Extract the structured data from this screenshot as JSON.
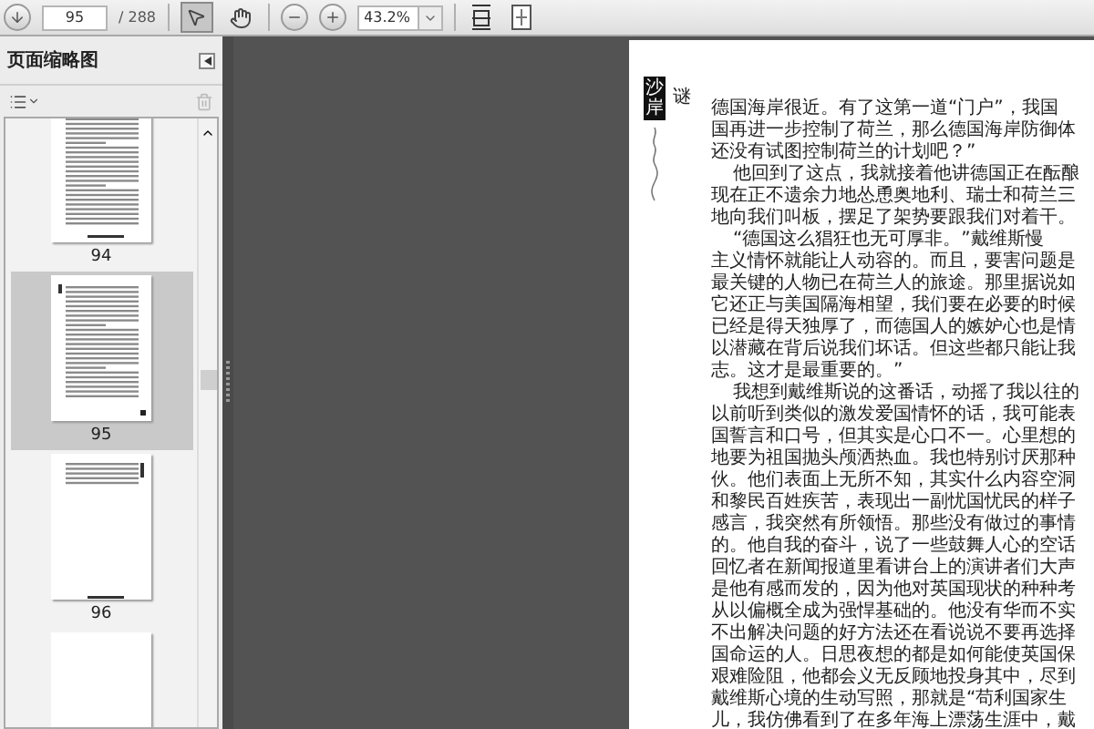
{
  "toolbar": {
    "page_input": "95",
    "page_total": "/ 288",
    "zoom_value": "43.2%",
    "tools": [
      {
        "kind": "select",
        "selected": true
      },
      {
        "kind": "hand",
        "selected": false
      }
    ]
  },
  "sidebar": {
    "title": "页面缩略图",
    "thumbnails": [
      {
        "kind": "text",
        "label": "94",
        "selected": false
      },
      {
        "kind": "chapter",
        "label": "95",
        "selected": true
      },
      {
        "kind": "short",
        "label": "96",
        "selected": false
      },
      {
        "kind": "blank",
        "selected": false
      }
    ]
  },
  "document": {
    "chapter_tag": "沙岸",
    "chapter_mark": "谜",
    "lines": [
      {
        "text": "德国海岸很近。有了这第一道“门户”，我国",
        "indent": false
      },
      {
        "text": "国再进一步控制了荷兰，那么德国海岸防御体",
        "indent": false
      },
      {
        "text": "还没有试图控制荷兰的计划吧？”",
        "indent": false
      },
      {
        "text": "他回到了这点，我就接着他讲德国正在酝酿",
        "indent": true
      },
      {
        "text": "现在正不遗余力地怂恿奥地利、瑞士和荷兰三",
        "indent": false
      },
      {
        "text": "地向我们叫板，摆足了架势要跟我们对着干。",
        "indent": false
      },
      {
        "text": "“德国这么猖狂也无可厚非。”戴维斯慢",
        "indent": true
      },
      {
        "text": "主义情怀就能让人动容的。而且，要害问题是",
        "indent": false
      },
      {
        "text": "最关键的人物已在荷兰人的旅途。那里据说如",
        "indent": false
      },
      {
        "text": "它还正与美国隔海相望，我们要在必要的时候",
        "indent": false
      },
      {
        "text": "已经是得天独厚了，而德国人的嫉妒心也是情",
        "indent": false
      },
      {
        "text": "以潜藏在背后说我们坏话。但这些都只能让我",
        "indent": false
      },
      {
        "text": "志。这才是最重要的。”",
        "indent": false
      },
      {
        "text": "我想到戴维斯说的这番话，动摇了我以往的",
        "indent": true
      },
      {
        "text": "以前听到类似的激发爱国情怀的话，我可能表",
        "indent": false
      },
      {
        "text": "国誓言和口号，但其实是心口不一。心里想的",
        "indent": false
      },
      {
        "text": "地要为祖国抛头颅洒热血。我也特别讨厌那种",
        "indent": false
      },
      {
        "text": "伙。他们表面上无所不知，其实什么内容空洞",
        "indent": false
      },
      {
        "text": "和黎民百姓疾苦，表现出一副忧国忧民的样子",
        "indent": false
      },
      {
        "text": "感言，我突然有所领悟。那些没有做过的事情",
        "indent": false
      },
      {
        "text": "的。他自我的奋斗，说了一些鼓舞人心的空话",
        "indent": false
      },
      {
        "text": "回忆者在新闻报道里看讲台上的演讲者们大声",
        "indent": false
      },
      {
        "text": "是他有感而发的，因为他对英国现状的种种考",
        "indent": false
      },
      {
        "text": "从以偏概全成为强悍基础的。他没有华而不实",
        "indent": false
      },
      {
        "text": "不出解决问题的好方法还在看说说不要再选择",
        "indent": false
      },
      {
        "text": "国命运的人。日思夜想的都是如何能使英国保",
        "indent": false
      },
      {
        "text": "艰难险阻，他都会义无反顾地投身其中，尽到",
        "indent": false
      },
      {
        "text": "戴维斯心境的生动写照，那就是“苟利国家生",
        "indent": false
      },
      {
        "text": "儿，我仿佛看到了在多年海上漂荡生涯中，戴",
        "indent": false
      }
    ]
  }
}
